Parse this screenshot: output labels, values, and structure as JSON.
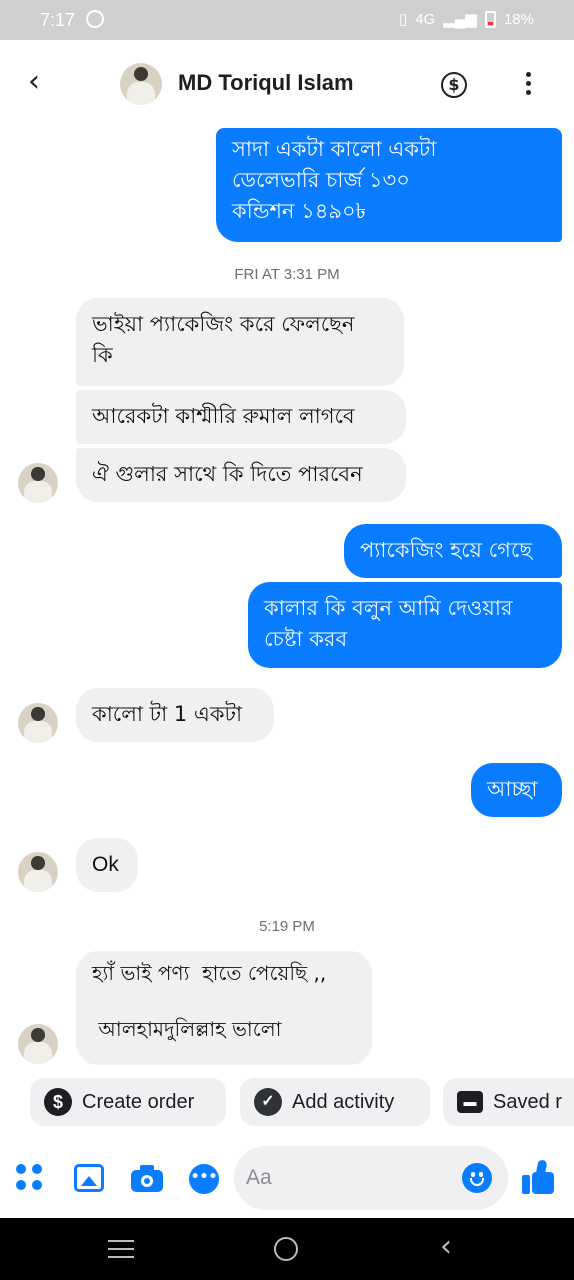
{
  "status": {
    "time": "7:17",
    "network": "4G",
    "battery": "18%"
  },
  "header": {
    "contact_name": "MD Toriqul Islam"
  },
  "messages": [
    {
      "dir": "out",
      "text": "সাদা একটা কালো একটা\nডেলেভারি চার্জ ১৩০\nকন্ডিশন ১৪৯০৳"
    },
    {
      "dir": "in",
      "text": "ভাইয়া প্যাকেজিং করে ফেলছেন\nকি"
    },
    {
      "dir": "in",
      "text": "আরেকটা কাশ্মীরি রুমাল লাগবে"
    },
    {
      "dir": "in",
      "text": "ঐ গুলার সাথে কি দিতে পারবেন"
    },
    {
      "dir": "out",
      "text": "প্যাকেজিং হয়ে গেছে"
    },
    {
      "dir": "out",
      "text": "কালার কি বলুন আমি দেওয়ার\nচেষ্টা করব"
    },
    {
      "dir": "in",
      "text": "কালো টা 1 একটা"
    },
    {
      "dir": "out",
      "text": "আচ্ছা"
    },
    {
      "dir": "in",
      "text": "Ok"
    },
    {
      "dir": "in",
      "text": "হ্যাঁ ভাই পণ্য  হাতে পেয়েছি ,,\n\n আলহামদুলিল্লাহ ভালো"
    }
  ],
  "timestamps": [
    "FRI AT 3:31 PM",
    "5:19 PM"
  ],
  "quick_actions": [
    {
      "label": "Create order",
      "icon": "dollar-icon"
    },
    {
      "label": "Add activity",
      "icon": "check-icon"
    },
    {
      "label": "Saved r",
      "icon": "saved-replies-icon"
    }
  ],
  "composer": {
    "placeholder": "Aa"
  }
}
